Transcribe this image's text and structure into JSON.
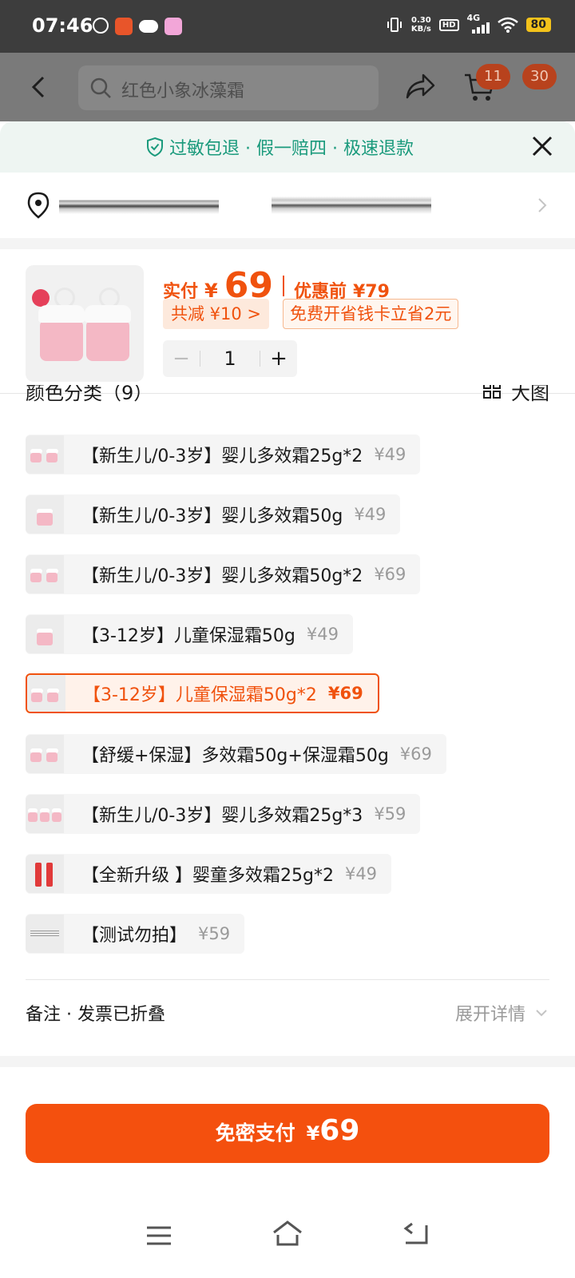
{
  "status_bar": {
    "time": "07:46",
    "speed_value": "0.30",
    "speed_unit": "KB/s",
    "hd": "HD",
    "network": "4G",
    "battery": "80"
  },
  "header": {
    "search_text": "红色小象冰藻霜",
    "cart_badge": "11",
    "more_badge": "30"
  },
  "sheet": {
    "guarantee": "过敏包退 · 假一赔四 · 极速退款",
    "product": {
      "paid_label": "实付",
      "currency": "¥",
      "price": "69",
      "original_label": "优惠前",
      "original_price": "¥79",
      "discount_chip": "共减 ¥10 >",
      "card_chip": "免费开省钱卡立省2元",
      "quantity": "1",
      "minus": "−",
      "plus": "+"
    },
    "variant_section": {
      "title": "颜色分类（9）",
      "view_label": "大图"
    },
    "variants": [
      {
        "label": "【新生儿/0-3岁】婴儿多效霜25g*2",
        "price": "¥49"
      },
      {
        "label": "【新生儿/0-3岁】婴儿多效霜50g",
        "price": "¥49"
      },
      {
        "label": "【新生儿/0-3岁】婴儿多效霜50g*2",
        "price": "¥69"
      },
      {
        "label": "【3-12岁】儿童保湿霜50g",
        "price": "¥49"
      },
      {
        "label": "【3-12岁】儿童保湿霜50g*2",
        "price": "¥69"
      },
      {
        "label": "【舒缓+保湿】多效霜50g+保湿霜50g",
        "price": "¥69"
      },
      {
        "label": "【新生儿/0-3岁】婴儿多效霜25g*3",
        "price": "¥59"
      },
      {
        "label": "【全新升级 】婴童多效霜25g*2",
        "price": "¥49"
      },
      {
        "label": "【测试勿拍】",
        "price": "¥59"
      }
    ],
    "note": {
      "label": "备注 · 发票已折叠",
      "expand": "展开详情"
    },
    "pay_button": {
      "label": "免密支付",
      "currency": "¥",
      "amount": "69"
    }
  },
  "colors": {
    "accent": "#f0520e",
    "guarantee_green": "#1a9a7c",
    "pay_button": "#f4500e"
  }
}
